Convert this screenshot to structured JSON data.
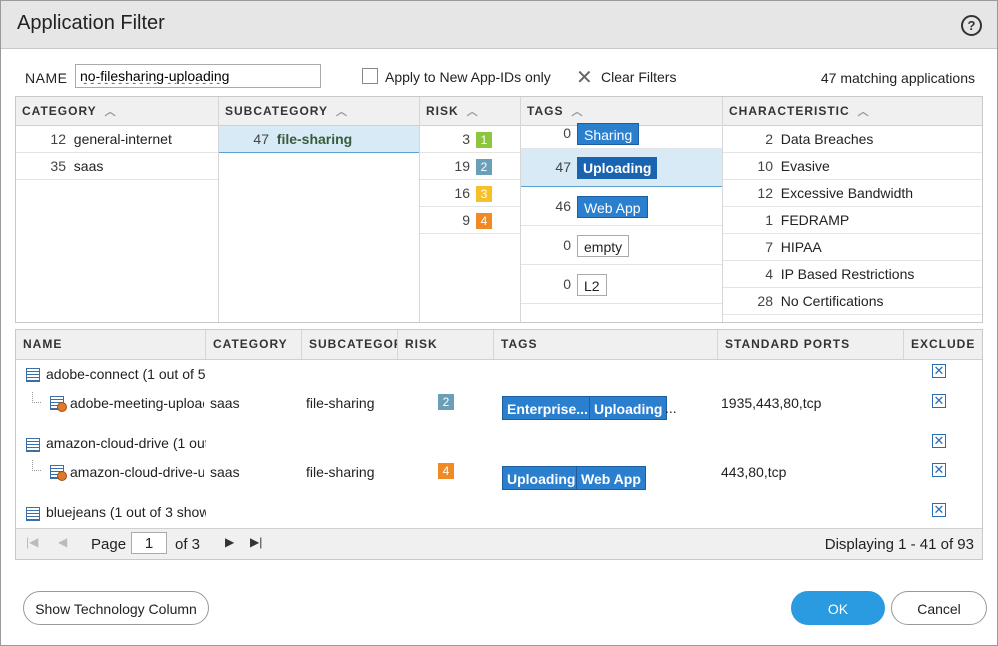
{
  "dialog": {
    "title": "Application Filter",
    "help_icon": "?"
  },
  "name_row": {
    "label": "NAME",
    "value": "no-filesharing-uploading",
    "apply_new_label": "Apply to New App-IDs only",
    "clear_filters_label": "Clear Filters",
    "matching": "47 matching applications"
  },
  "facets": {
    "category": {
      "header": "CATEGORY",
      "rows": [
        {
          "count": "12",
          "label": "general-internet"
        },
        {
          "count": "35",
          "label": "saas"
        }
      ]
    },
    "subcategory": {
      "header": "SUBCATEGORY",
      "rows": [
        {
          "count": "47",
          "label": "file-sharing"
        }
      ]
    },
    "risk": {
      "header": "RISK",
      "rows": [
        {
          "count": "3",
          "level": "1"
        },
        {
          "count": "19",
          "level": "2"
        },
        {
          "count": "16",
          "level": "3"
        },
        {
          "count": "9",
          "level": "4"
        }
      ]
    },
    "tags": {
      "header": "TAGS",
      "rows": [
        {
          "count": "0",
          "label": "Sharing"
        },
        {
          "count": "47",
          "label": "Uploading"
        },
        {
          "count": "46",
          "label": "Web App"
        },
        {
          "count": "0",
          "label": "empty"
        },
        {
          "count": "0",
          "label": "L2"
        }
      ]
    },
    "characteristic": {
      "header": "CHARACTERISTIC",
      "rows": [
        {
          "count": "2",
          "label": "Data Breaches"
        },
        {
          "count": "10",
          "label": "Evasive"
        },
        {
          "count": "12",
          "label": "Excessive Bandwidth"
        },
        {
          "count": "1",
          "label": "FEDRAMP"
        },
        {
          "count": "7",
          "label": "HIPAA"
        },
        {
          "count": "4",
          "label": "IP Based Restrictions"
        },
        {
          "count": "28",
          "label": "No Certifications"
        }
      ]
    }
  },
  "grid": {
    "headers": {
      "name": "NAME",
      "category": "CATEGORY",
      "subcategory": "SUBCATEGORY",
      "risk": "RISK",
      "tags": "TAGS",
      "ports": "STANDARD PORTS",
      "exclude": "EXCLUDE"
    },
    "rows": [
      {
        "group": "adobe-connect (1 out of 5"
      },
      {
        "name": "adobe-meeting-upload",
        "category": "saas",
        "subcategory": "file-sharing",
        "risk": "2",
        "tags": [
          "Enterprise...",
          "Uploading"
        ],
        "more": "...",
        "ports": "1935,443,80,tcp"
      },
      {
        "group": "amazon-cloud-drive (1 out"
      },
      {
        "name": "amazon-cloud-drive-uploading",
        "category": "saas",
        "subcategory": "file-sharing",
        "risk": "4",
        "tags": [
          "Uploading",
          "Web App"
        ],
        "ports": "443,80,tcp"
      },
      {
        "group": "bluejeans (1 out of 3 show"
      }
    ],
    "pager": {
      "page_label": "Page",
      "page_value": "1",
      "of_label": "of 3",
      "display": "Displaying 1 - 41 of 93"
    }
  },
  "buttons": {
    "tech": "Show Technology Column",
    "ok": "OK",
    "cancel": "Cancel"
  },
  "colors": {
    "risk1": "#8cc63e",
    "risk2": "#6a9fb8",
    "risk3": "#f5c02a",
    "risk4": "#f08a24",
    "accent": "#2a9be0"
  }
}
